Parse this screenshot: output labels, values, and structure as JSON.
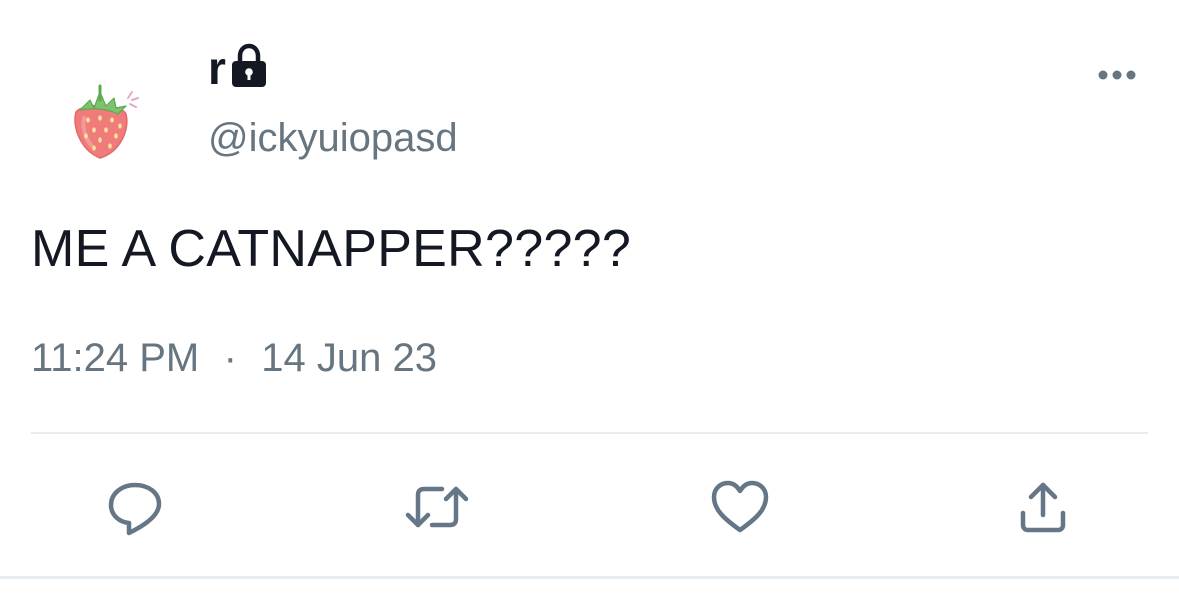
{
  "tweet": {
    "author": {
      "display_name": "r",
      "handle": "@ickyuiopasd",
      "avatar_icon": "strawberry-avatar",
      "protected_icon": "lock-icon"
    },
    "text": "ME A CATNAPPER?????",
    "time": "11:24 PM",
    "separator": "·",
    "date": "14 Jun 23"
  },
  "actions": [
    {
      "name": "reply",
      "icon": "reply-icon"
    },
    {
      "name": "retweet",
      "icon": "retweet-icon"
    },
    {
      "name": "like",
      "icon": "heart-icon"
    },
    {
      "name": "share",
      "icon": "share-icon"
    }
  ],
  "more_menu_icon": "more-horizontal-icon",
  "colors": {
    "text_primary": "#141823",
    "text_secondary": "#66757f",
    "divider": "#e6ecf0",
    "icon": "#657786",
    "strawberry": "#ef7b7b",
    "strawberry_leaf": "#7cc36b"
  }
}
